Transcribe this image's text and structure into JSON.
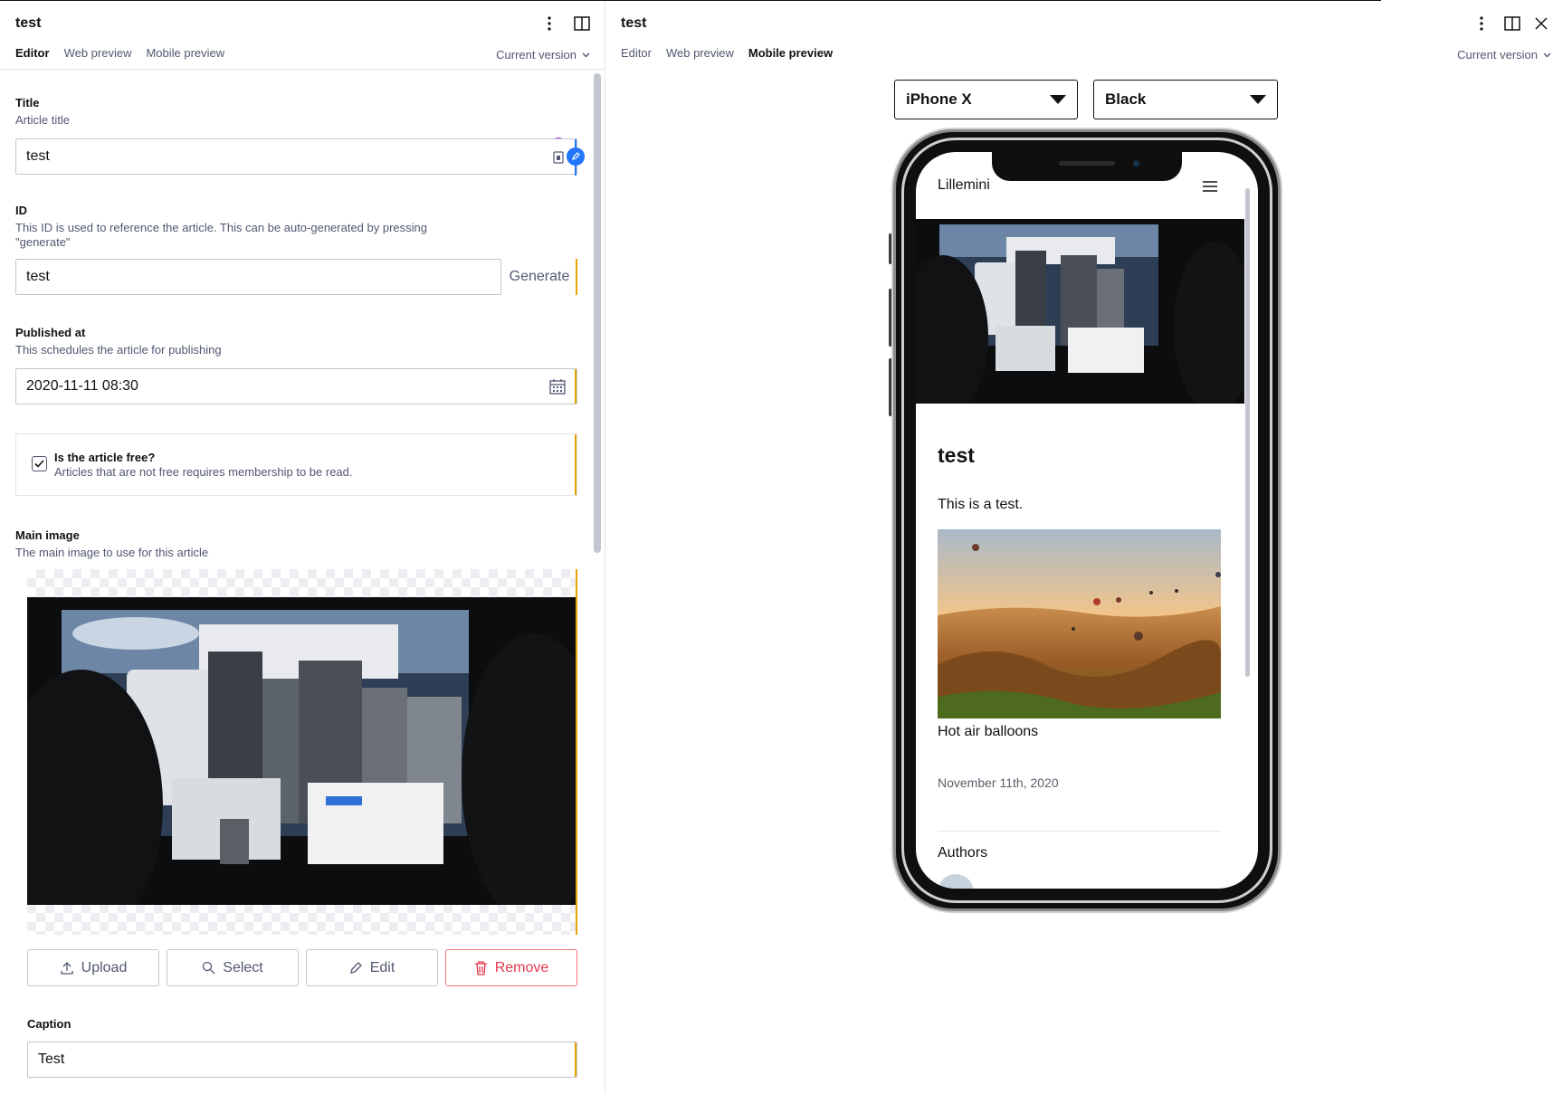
{
  "left_pane": {
    "title": "test",
    "tabs": [
      "Editor",
      "Web preview",
      "Mobile preview"
    ],
    "version": "Current version",
    "fields": {
      "title": {
        "label": "Title",
        "description": "Article title",
        "value": "test",
        "avatar": "PB"
      },
      "id": {
        "label": "ID",
        "description": "This ID is used to reference the article. This can be auto-generated by pressing \"generate\"",
        "value": "test",
        "generate_label": "Generate"
      },
      "published": {
        "label": "Published at",
        "description": "This schedules the article for publishing",
        "value": "2020-11-11 08:30"
      },
      "free": {
        "label": "Is the article free?",
        "description": "Articles that are not free requires membership to be read.",
        "checked": true
      },
      "main_image": {
        "label": "Main image",
        "description": "The main image to use for this article"
      },
      "caption": {
        "label": "Caption",
        "value": "Test"
      }
    },
    "image_buttons": {
      "upload": "Upload",
      "select": "Select",
      "edit": "Edit",
      "remove": "Remove"
    }
  },
  "right_pane": {
    "title": "test",
    "tabs": [
      "Editor",
      "Web preview",
      "Mobile preview"
    ],
    "version": "Current version",
    "device_select": "iPhone X",
    "color_select": "Black",
    "preview": {
      "site_name": "Lillemini",
      "article_title": "test",
      "body": "This is a test.",
      "image_caption": "Hot air balloons",
      "date": "November 11th, 2020",
      "authors_heading": "Authors"
    }
  },
  "colors": {
    "changed_indicator": "#e5a200",
    "presence": "#2276fc",
    "avatar": "#c21cd6",
    "danger": "#e4354a"
  }
}
